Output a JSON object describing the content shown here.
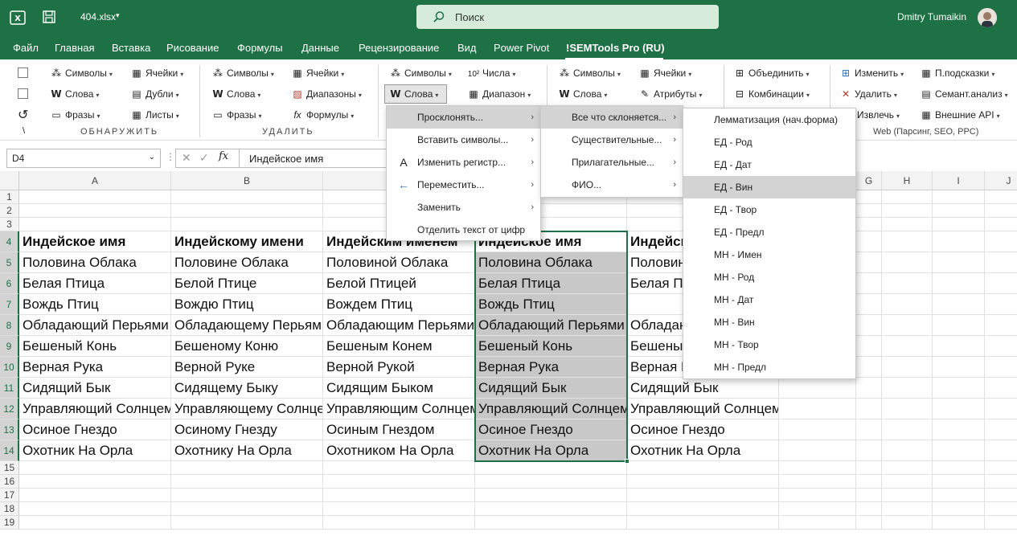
{
  "titlebar": {
    "filename": "404.xlsx",
    "search_placeholder": "Поиск",
    "user": "Dmitry Tumaikin"
  },
  "tabs": [
    "Файл",
    "Главная",
    "Вставка",
    "Рисование",
    "Формулы",
    "Данные",
    "Рецензирование",
    "Вид",
    "Power Pivot",
    "!SEMTools Pro (RU)"
  ],
  "ribbon": {
    "g1": {
      "symbols": "Символы",
      "words": "Слова",
      "phrases": "Фразы",
      "cells": "Ячейки",
      "dupes": "Дубли",
      "sheets": "Листы",
      "label": "ОБНАРУЖИТЬ"
    },
    "g2": {
      "symbols": "Символы",
      "words": "Слова",
      "phrases": "Фразы",
      "cells": "Ячейки",
      "ranges": "Диапазоны",
      "formulas": "Формулы",
      "label": "УДАЛИТЬ"
    },
    "g3": {
      "symbols": "Символы",
      "words": "Слова",
      "numbers": "Числа",
      "range": "Диапазон"
    },
    "g4": {
      "symbols": "Символы",
      "words": "Слова",
      "cells": "Ячейки",
      "attrs": "Атрибуты"
    },
    "g5": {
      "merge": "Объединить",
      "combos": "Комбинации"
    },
    "g6": {
      "change": "Изменить",
      "delete": "Удалить",
      "extract": "Извлечь",
      "hints": "П.подсказки",
      "semantic": "Семант.анализ",
      "api": "Внешние API",
      "label": "Web (Парсинг, SEO, PPC)"
    },
    "backslash": "\\"
  },
  "formula_bar": {
    "cell_ref": "D4",
    "formula": "Индейское имя"
  },
  "columns": [
    "A",
    "B",
    "C",
    "D",
    "E",
    "F",
    "G",
    "H",
    "I",
    "J"
  ],
  "rows": [
    "1",
    "2",
    "3",
    "4",
    "5",
    "6",
    "7",
    "8",
    "9",
    "10",
    "11",
    "12",
    "13",
    "14",
    "15",
    "16",
    "17",
    "18",
    "19"
  ],
  "sheet": {
    "A": [
      "Индейское имя",
      "Половина Облака",
      "Белая Птица",
      "Вождь Птиц",
      "Обладающий Перьями",
      "Бешеный Конь",
      "Верная Рука",
      "Сидящий Бык",
      "Управляющий Солнцем",
      "Осиное Гнездо",
      "Охотник На Орла"
    ],
    "B": [
      "Индейскому имени",
      "Половине Облака",
      "Белой Птице",
      "Вождю Птиц",
      "Обладающему Перьями",
      "Бешеному Коню",
      "Верной Руке",
      "Сидящему Быку",
      "Управляющему Солнцем",
      "Осиному Гнезду",
      "Охотнику На Орла"
    ],
    "C": [
      "Индейским именем",
      "Половиной Облака",
      "Белой Птицей",
      "Вождем Птиц",
      "Обладающим Перьями",
      "Бешеным Конем",
      "Верной Рукой",
      "Сидящим Быком",
      "Управляющим Солнцем",
      "Осиным Гнездом",
      "Охотником На Орла"
    ],
    "D": [
      "Индейское имя",
      "Половина Облака",
      "Белая Птица",
      "Вождь Птиц",
      "Обладающий Перьями",
      "Бешеный Конь",
      "Верная Рука",
      "Сидящий Бык",
      "Управляющий Солнцем",
      "Осиное Гнездо",
      "Охотник На Орла"
    ],
    "E": [
      "Индейск",
      "Половин",
      "Белая Пт",
      "",
      "Обладаю",
      "Бешены",
      "Верная Р",
      "Сидящий Бык",
      "Управляющий Солнцем",
      "Осиное Гнездо",
      "Охотник На Орла"
    ]
  },
  "menu1": [
    {
      "label": "Просклонять...",
      "icon": "",
      "arrow": "›"
    },
    {
      "label": "Вставить символы...",
      "icon": "",
      "arrow": "›"
    },
    {
      "label": "Изменить регистр...",
      "icon": "A",
      "arrow": "›"
    },
    {
      "label": "Переместить...",
      "icon": "←",
      "arrow": "›"
    },
    {
      "label": "Заменить",
      "icon": "",
      "arrow": "›"
    },
    {
      "label": "Отделить текст от цифр",
      "icon": "",
      "arrow": ""
    }
  ],
  "menu2": [
    {
      "label": "Все что склоняется...",
      "arrow": "›"
    },
    {
      "label": "Существительные...",
      "arrow": "›"
    },
    {
      "label": "Прилагательные...",
      "arrow": "›"
    },
    {
      "label": "ФИО...",
      "arrow": "›"
    }
  ],
  "menu3": [
    "Лемматизация (нач.форма)",
    "ЕД - Род",
    "ЕД - Дат",
    "ЕД - Вин",
    "ЕД - Твор",
    "ЕД - Предл",
    "МН - Имен",
    "МН - Род",
    "МН - Дат",
    "МН - Вин",
    "МН - Твор",
    "МН - Предл"
  ],
  "colors": {
    "accent": "#1e7145",
    "selection": "#c8c8c8",
    "highlight": "#d3d3d3"
  }
}
